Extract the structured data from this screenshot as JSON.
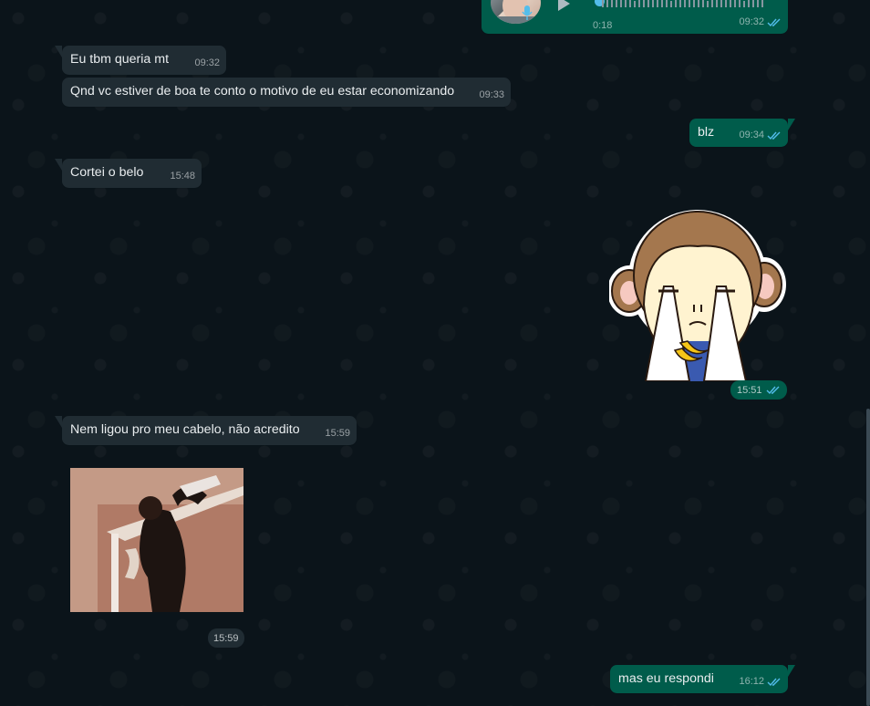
{
  "colors": {
    "chat_background": "#0b141a",
    "incoming_bubble": "#202c33",
    "outgoing_bubble": "#005c4b",
    "read_tick": "#53bdeb"
  },
  "voice_message": {
    "duration": "0:18",
    "time": "09:32",
    "status": "read",
    "icons": [
      "avatar",
      "mic-icon",
      "play-icon",
      "waveform"
    ]
  },
  "messages": [
    {
      "id": "m1",
      "direction": "in",
      "text": "Eu tbm queria mt",
      "time": "09:32"
    },
    {
      "id": "m2",
      "direction": "in",
      "text": "Qnd vc estiver de boa te conto o motivo de eu estar economizando",
      "time": "09:33"
    },
    {
      "id": "m3",
      "direction": "out",
      "text": "blz",
      "time": "09:34",
      "status": "read"
    },
    {
      "id": "m4",
      "direction": "in",
      "text": "Cortei o belo",
      "time": "15:48"
    },
    {
      "id": "m6",
      "direction": "in",
      "text": "Nem ligou pro meu cabelo, não acredito",
      "time": "15:59"
    },
    {
      "id": "m8",
      "direction": "out",
      "text": "mas eu respondi",
      "time": "16:12",
      "status": "read"
    }
  ],
  "sticker": {
    "icon": "crying-monkey-sticker",
    "time": "15:51",
    "status": "read"
  },
  "video": {
    "icon": "video-thumbnail",
    "time": "15:59"
  }
}
